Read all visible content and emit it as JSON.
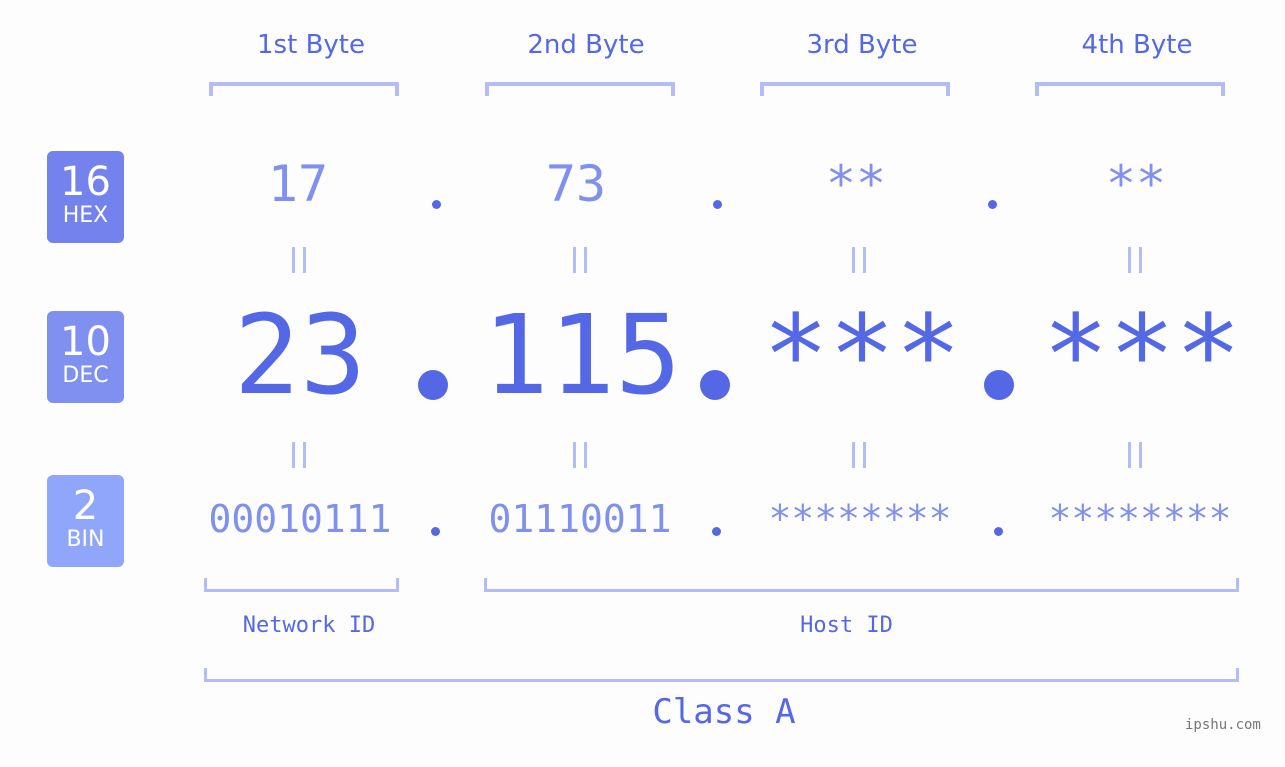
{
  "colors": {
    "accent": "#5468e6",
    "light_value": "#8090ee",
    "bracket": "#b2bdf7",
    "hex_badge": "#7382ec",
    "dec_badge": "#8090f0",
    "bin_badge": "#8fa6fa",
    "background": "#fcfdfc"
  },
  "bytes": [
    {
      "label": "1st Byte",
      "hex": "17",
      "dec": "23",
      "bin": "00010111"
    },
    {
      "label": "2nd Byte",
      "hex": "73",
      "dec": "115",
      "bin": "01110011"
    },
    {
      "label": "3rd Byte",
      "hex": "**",
      "dec": "***",
      "bin": "********"
    },
    {
      "label": "4th Byte",
      "hex": "**",
      "dec": "***",
      "bin": "********"
    }
  ],
  "rows": {
    "hex": {
      "base": "16",
      "name": "HEX"
    },
    "dec": {
      "base": "10",
      "name": "DEC"
    },
    "bin": {
      "base": "2",
      "name": "BIN"
    }
  },
  "segments": {
    "network": "Network ID",
    "host": "Host ID"
  },
  "class_label": "Class A",
  "watermark": "ipshu.com"
}
